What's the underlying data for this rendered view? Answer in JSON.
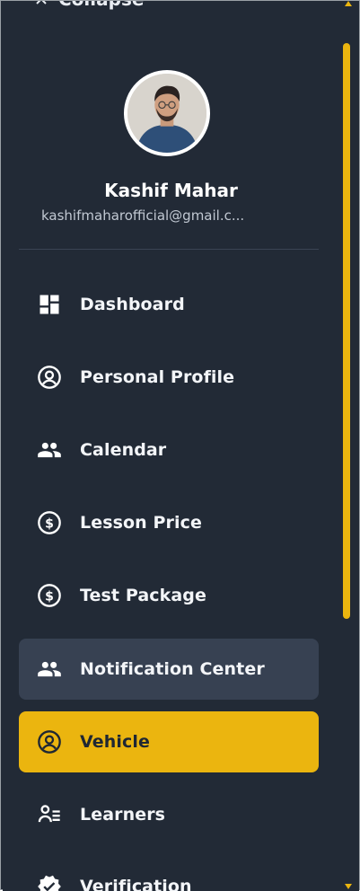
{
  "sidebar": {
    "collapse_label": "Collapse",
    "user": {
      "name": "Kashif Mahar",
      "email": "kashifmaharofficial@gmail.c..."
    },
    "items": [
      {
        "label": "Dashboard",
        "icon": "dashboard-icon"
      },
      {
        "label": "Personal Profile",
        "icon": "account-circle-icon"
      },
      {
        "label": "Calendar",
        "icon": "people-icon"
      },
      {
        "label": "Lesson Price",
        "icon": "dollar-circle-icon"
      },
      {
        "label": "Test Package",
        "icon": "dollar-circle-icon"
      },
      {
        "label": "Notification Center",
        "icon": "people-icon",
        "state": "hover"
      },
      {
        "label": "Vehicle",
        "icon": "account-circle-icon",
        "state": "active"
      },
      {
        "label": "Learners",
        "icon": "person-list-icon"
      },
      {
        "label": "Verification",
        "icon": "verified-badge-icon"
      }
    ]
  },
  "colors": {
    "sidebar_bg": "#222a36",
    "accent": "#ebb50f",
    "hover_bg": "#374152",
    "text": "#f3f5f8"
  }
}
